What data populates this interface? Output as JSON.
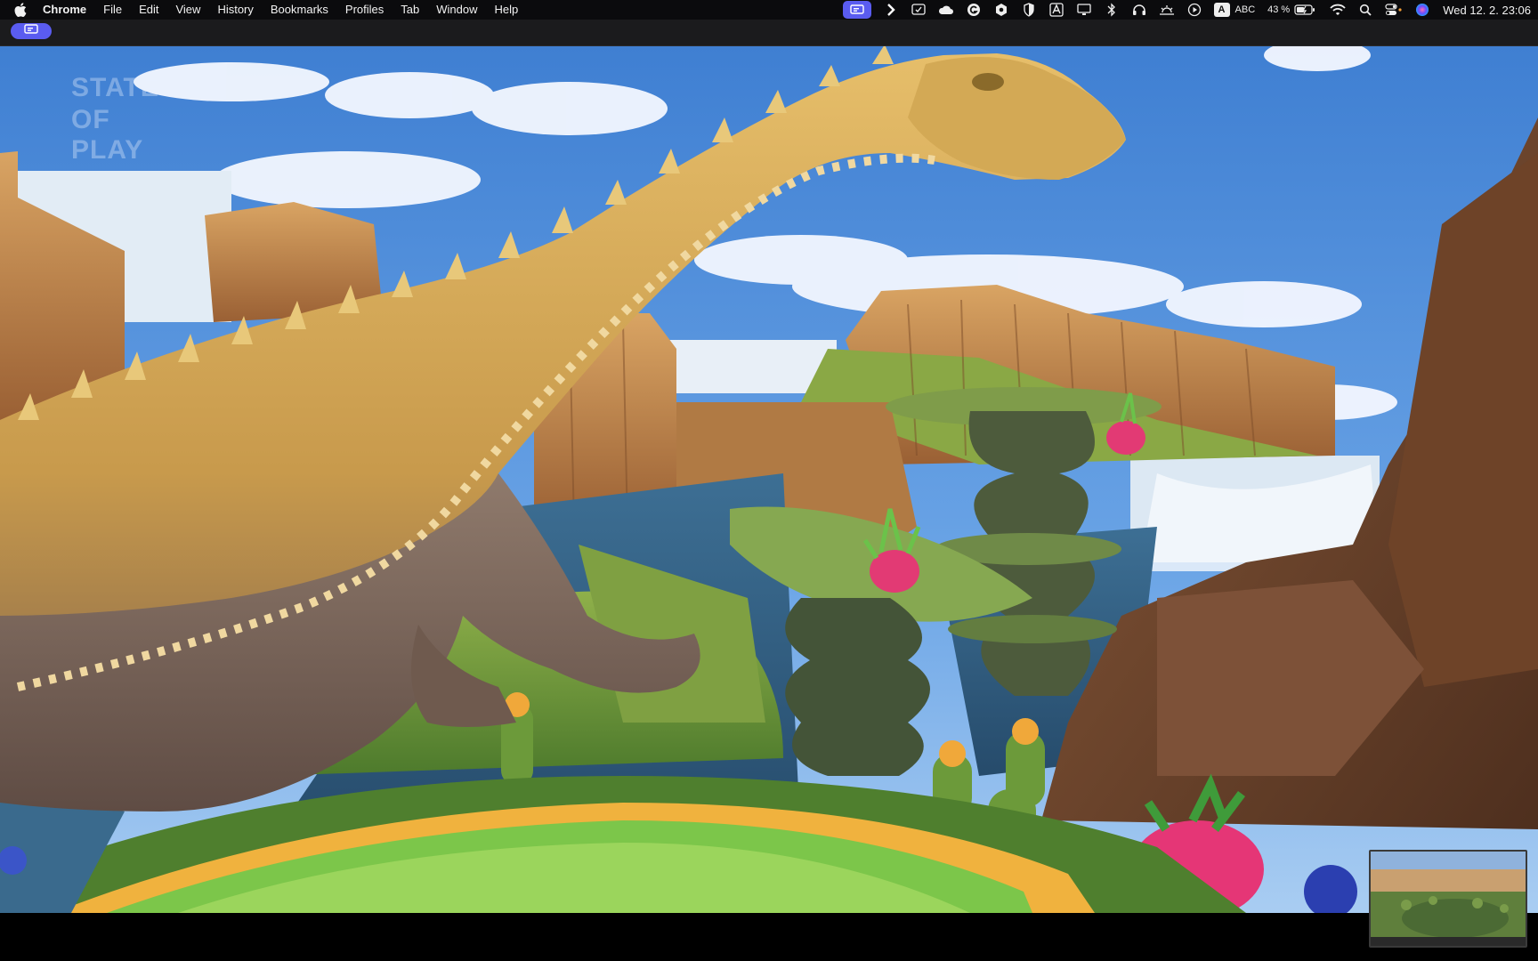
{
  "menubar": {
    "app_name": "Chrome",
    "items": [
      "File",
      "Edit",
      "View",
      "History",
      "Bookmarks",
      "Profiles",
      "Tab",
      "Window",
      "Help"
    ],
    "status": {
      "keyboard_layout": "ABC",
      "input_badge": "A",
      "battery": "43 %",
      "clock": "Wed 12. 2.  23:06"
    },
    "icons": [
      "screen-share-icon",
      "chevron-right-icon",
      "shield-check-icon",
      "cloud-icon",
      "grammarly-icon",
      "cube-icon",
      "half-shield-icon",
      "text-box-icon",
      "display-icon",
      "bluetooth-icon",
      "headphones-icon",
      "sunrise-icon",
      "play-circle-icon",
      "battery-icon",
      "wifi-icon",
      "search-icon",
      "control-center-icon",
      "siri-icon"
    ]
  },
  "video": {
    "watermark": {
      "line1": "STATE",
      "line2": "OF PLAY"
    }
  },
  "colors": {
    "accent": "#5a5cf0",
    "menubar_bg": "#0b0b0d",
    "sky": "#3b78c8"
  }
}
